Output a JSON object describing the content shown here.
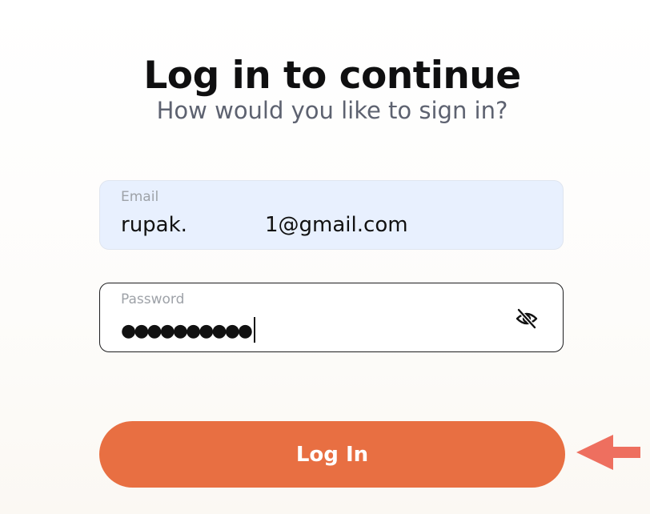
{
  "header": {
    "title": "Log in to continue",
    "subtitle": "How would you like to sign in?"
  },
  "form": {
    "email": {
      "label": "Email",
      "value_prefix": "rupak.",
      "value_suffix": "1@gmail.com"
    },
    "password": {
      "label": "Password",
      "masked_value": "●●●●●●●●●●",
      "visibility_icon": "eye-slash-icon"
    },
    "submit_label": "Log In"
  },
  "annotation": {
    "icon": "arrow-left-icon",
    "color": "#ee6f5f"
  },
  "colors": {
    "accent": "#e86f42",
    "email_field_bg": "#e8f0fe"
  }
}
